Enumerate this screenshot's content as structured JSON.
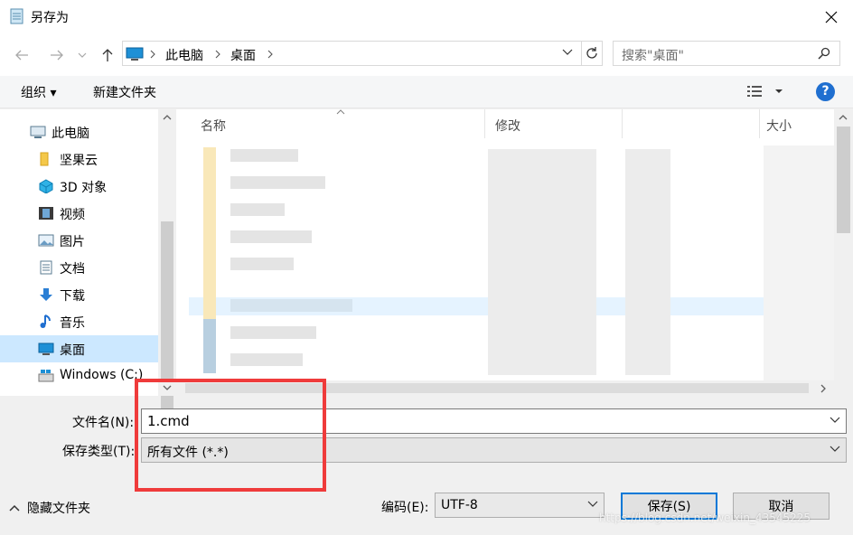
{
  "window": {
    "title": "另存为"
  },
  "nav": {
    "breadcrumb": [
      "此电脑",
      "桌面"
    ],
    "search_placeholder": "搜索\"桌面\""
  },
  "toolbar": {
    "organize_label": "组织 ▾",
    "new_folder_label": "新建文件夹"
  },
  "sidebar": {
    "items": [
      {
        "label": "此电脑",
        "icon": "computer-icon"
      },
      {
        "label": "坚果云",
        "icon": "folder-icon"
      },
      {
        "label": "3D 对象",
        "icon": "cube-3d-icon"
      },
      {
        "label": "视频",
        "icon": "video-icon"
      },
      {
        "label": "图片",
        "icon": "picture-icon"
      },
      {
        "label": "文档",
        "icon": "document-icon"
      },
      {
        "label": "下载",
        "icon": "download-icon"
      },
      {
        "label": "音乐",
        "icon": "music-icon"
      },
      {
        "label": "桌面",
        "icon": "desktop-icon"
      },
      {
        "label": "Windows (C:)",
        "icon": "drive-icon"
      }
    ]
  },
  "filelist": {
    "columns": [
      "名称",
      "修改",
      "大小"
    ]
  },
  "form": {
    "filename_label": "文件名(N):",
    "filename_value": "1.cmd",
    "filetype_label": "保存类型(T):",
    "filetype_value": "所有文件  (*.*)",
    "encoding_label": "编码(E):",
    "encoding_value": "UTF-8"
  },
  "footer": {
    "hide_folders_label": "隐藏文件夹",
    "save_label": "保存(S)",
    "cancel_label": "取消"
  },
  "watermark": "https://blog.csdn.net/weixin_43545225",
  "colors": {
    "accent": "#0078d7",
    "highlight": "#ef3b3b",
    "selected": "#cce8ff"
  }
}
